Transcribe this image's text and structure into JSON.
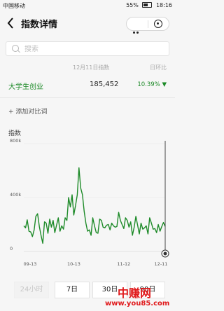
{
  "status_bar": {
    "carrier": "中国移动",
    "battery": "55%",
    "time": "18:16"
  },
  "nav": {
    "title": "指数详情"
  },
  "search": {
    "placeholder": "搜索"
  },
  "table": {
    "date_header": "12月11日指数",
    "change_header": "日环比",
    "keyword": "大学生创业",
    "value": "185,452",
    "change": "10.39%"
  },
  "add_compare": "+ 添加对比词",
  "chart_data": {
    "type": "line",
    "title": "",
    "ylabel": "指数",
    "xlabel": "",
    "x_ticks": [
      "09-13",
      "10-13",
      "11-12",
      "12-11"
    ],
    "y_ticks": [
      "800k",
      "400k",
      "0"
    ],
    "ylim": [
      0,
      800000
    ],
    "series": [
      {
        "values": [
          190000,
          175000,
          235000,
          150000,
          145000,
          110000,
          160000,
          260000,
          280000,
          185000,
          120000,
          60000,
          220000,
          210000,
          135000,
          240000,
          180000,
          230000,
          140000,
          195000,
          250000,
          150000,
          190000,
          165000,
          250000,
          230000,
          400000,
          330000,
          420000,
          270000,
          340000,
          420000,
          620000,
          470000,
          420000,
          300000,
          210000,
          150000,
          160000,
          120000,
          250000,
          190000,
          140000,
          135000,
          240000,
          230000,
          180000,
          175000,
          195000,
          200000,
          160000,
          210000,
          190000,
          180000,
          185000,
          290000,
          230000,
          200000,
          170000,
          250000,
          230000,
          180000,
          220000,
          120000,
          180000,
          260000,
          195000,
          130000,
          210000,
          165000,
          175000,
          190000,
          130000,
          250000,
          210000,
          165000,
          170000,
          140000,
          200000,
          150000,
          185000,
          215000,
          185452
        ]
      }
    ],
    "color": "#1d8a28",
    "marker_color": "#333333"
  },
  "periods": {
    "p24h": "24小时",
    "p7d": "7日",
    "p30d": "30日",
    "p90d": "90日"
  },
  "watermark": {
    "main": "中赚网",
    "sub": "www.you85.com"
  }
}
